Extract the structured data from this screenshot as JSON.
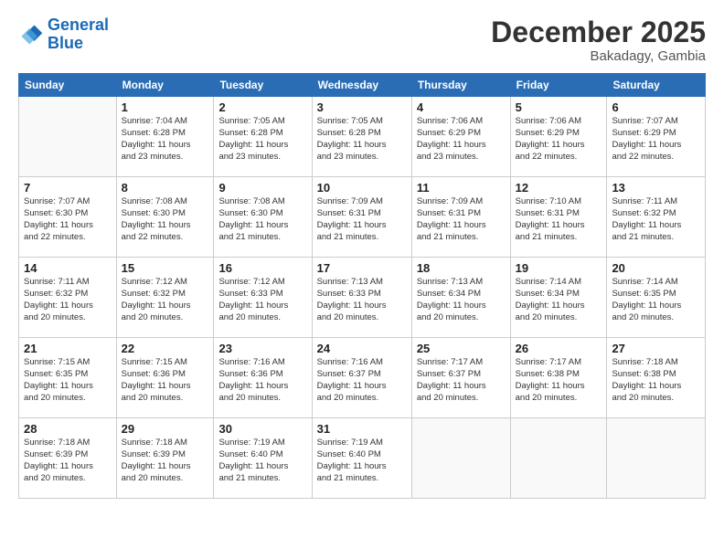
{
  "header": {
    "logo_line1": "General",
    "logo_line2": "Blue",
    "month_title": "December 2025",
    "location": "Bakadagy, Gambia"
  },
  "weekdays": [
    "Sunday",
    "Monday",
    "Tuesday",
    "Wednesday",
    "Thursday",
    "Friday",
    "Saturday"
  ],
  "weeks": [
    [
      {
        "day": "",
        "info": ""
      },
      {
        "day": "1",
        "info": "Sunrise: 7:04 AM\nSunset: 6:28 PM\nDaylight: 11 hours\nand 23 minutes."
      },
      {
        "day": "2",
        "info": "Sunrise: 7:05 AM\nSunset: 6:28 PM\nDaylight: 11 hours\nand 23 minutes."
      },
      {
        "day": "3",
        "info": "Sunrise: 7:05 AM\nSunset: 6:28 PM\nDaylight: 11 hours\nand 23 minutes."
      },
      {
        "day": "4",
        "info": "Sunrise: 7:06 AM\nSunset: 6:29 PM\nDaylight: 11 hours\nand 23 minutes."
      },
      {
        "day": "5",
        "info": "Sunrise: 7:06 AM\nSunset: 6:29 PM\nDaylight: 11 hours\nand 22 minutes."
      },
      {
        "day": "6",
        "info": "Sunrise: 7:07 AM\nSunset: 6:29 PM\nDaylight: 11 hours\nand 22 minutes."
      }
    ],
    [
      {
        "day": "7",
        "info": "Sunrise: 7:07 AM\nSunset: 6:30 PM\nDaylight: 11 hours\nand 22 minutes."
      },
      {
        "day": "8",
        "info": "Sunrise: 7:08 AM\nSunset: 6:30 PM\nDaylight: 11 hours\nand 22 minutes."
      },
      {
        "day": "9",
        "info": "Sunrise: 7:08 AM\nSunset: 6:30 PM\nDaylight: 11 hours\nand 21 minutes."
      },
      {
        "day": "10",
        "info": "Sunrise: 7:09 AM\nSunset: 6:31 PM\nDaylight: 11 hours\nand 21 minutes."
      },
      {
        "day": "11",
        "info": "Sunrise: 7:09 AM\nSunset: 6:31 PM\nDaylight: 11 hours\nand 21 minutes."
      },
      {
        "day": "12",
        "info": "Sunrise: 7:10 AM\nSunset: 6:31 PM\nDaylight: 11 hours\nand 21 minutes."
      },
      {
        "day": "13",
        "info": "Sunrise: 7:11 AM\nSunset: 6:32 PM\nDaylight: 11 hours\nand 21 minutes."
      }
    ],
    [
      {
        "day": "14",
        "info": "Sunrise: 7:11 AM\nSunset: 6:32 PM\nDaylight: 11 hours\nand 20 minutes."
      },
      {
        "day": "15",
        "info": "Sunrise: 7:12 AM\nSunset: 6:32 PM\nDaylight: 11 hours\nand 20 minutes."
      },
      {
        "day": "16",
        "info": "Sunrise: 7:12 AM\nSunset: 6:33 PM\nDaylight: 11 hours\nand 20 minutes."
      },
      {
        "day": "17",
        "info": "Sunrise: 7:13 AM\nSunset: 6:33 PM\nDaylight: 11 hours\nand 20 minutes."
      },
      {
        "day": "18",
        "info": "Sunrise: 7:13 AM\nSunset: 6:34 PM\nDaylight: 11 hours\nand 20 minutes."
      },
      {
        "day": "19",
        "info": "Sunrise: 7:14 AM\nSunset: 6:34 PM\nDaylight: 11 hours\nand 20 minutes."
      },
      {
        "day": "20",
        "info": "Sunrise: 7:14 AM\nSunset: 6:35 PM\nDaylight: 11 hours\nand 20 minutes."
      }
    ],
    [
      {
        "day": "21",
        "info": "Sunrise: 7:15 AM\nSunset: 6:35 PM\nDaylight: 11 hours\nand 20 minutes."
      },
      {
        "day": "22",
        "info": "Sunrise: 7:15 AM\nSunset: 6:36 PM\nDaylight: 11 hours\nand 20 minutes."
      },
      {
        "day": "23",
        "info": "Sunrise: 7:16 AM\nSunset: 6:36 PM\nDaylight: 11 hours\nand 20 minutes."
      },
      {
        "day": "24",
        "info": "Sunrise: 7:16 AM\nSunset: 6:37 PM\nDaylight: 11 hours\nand 20 minutes."
      },
      {
        "day": "25",
        "info": "Sunrise: 7:17 AM\nSunset: 6:37 PM\nDaylight: 11 hours\nand 20 minutes."
      },
      {
        "day": "26",
        "info": "Sunrise: 7:17 AM\nSunset: 6:38 PM\nDaylight: 11 hours\nand 20 minutes."
      },
      {
        "day": "27",
        "info": "Sunrise: 7:18 AM\nSunset: 6:38 PM\nDaylight: 11 hours\nand 20 minutes."
      }
    ],
    [
      {
        "day": "28",
        "info": "Sunrise: 7:18 AM\nSunset: 6:39 PM\nDaylight: 11 hours\nand 20 minutes."
      },
      {
        "day": "29",
        "info": "Sunrise: 7:18 AM\nSunset: 6:39 PM\nDaylight: 11 hours\nand 20 minutes."
      },
      {
        "day": "30",
        "info": "Sunrise: 7:19 AM\nSunset: 6:40 PM\nDaylight: 11 hours\nand 21 minutes."
      },
      {
        "day": "31",
        "info": "Sunrise: 7:19 AM\nSunset: 6:40 PM\nDaylight: 11 hours\nand 21 minutes."
      },
      {
        "day": "",
        "info": ""
      },
      {
        "day": "",
        "info": ""
      },
      {
        "day": "",
        "info": ""
      }
    ]
  ]
}
